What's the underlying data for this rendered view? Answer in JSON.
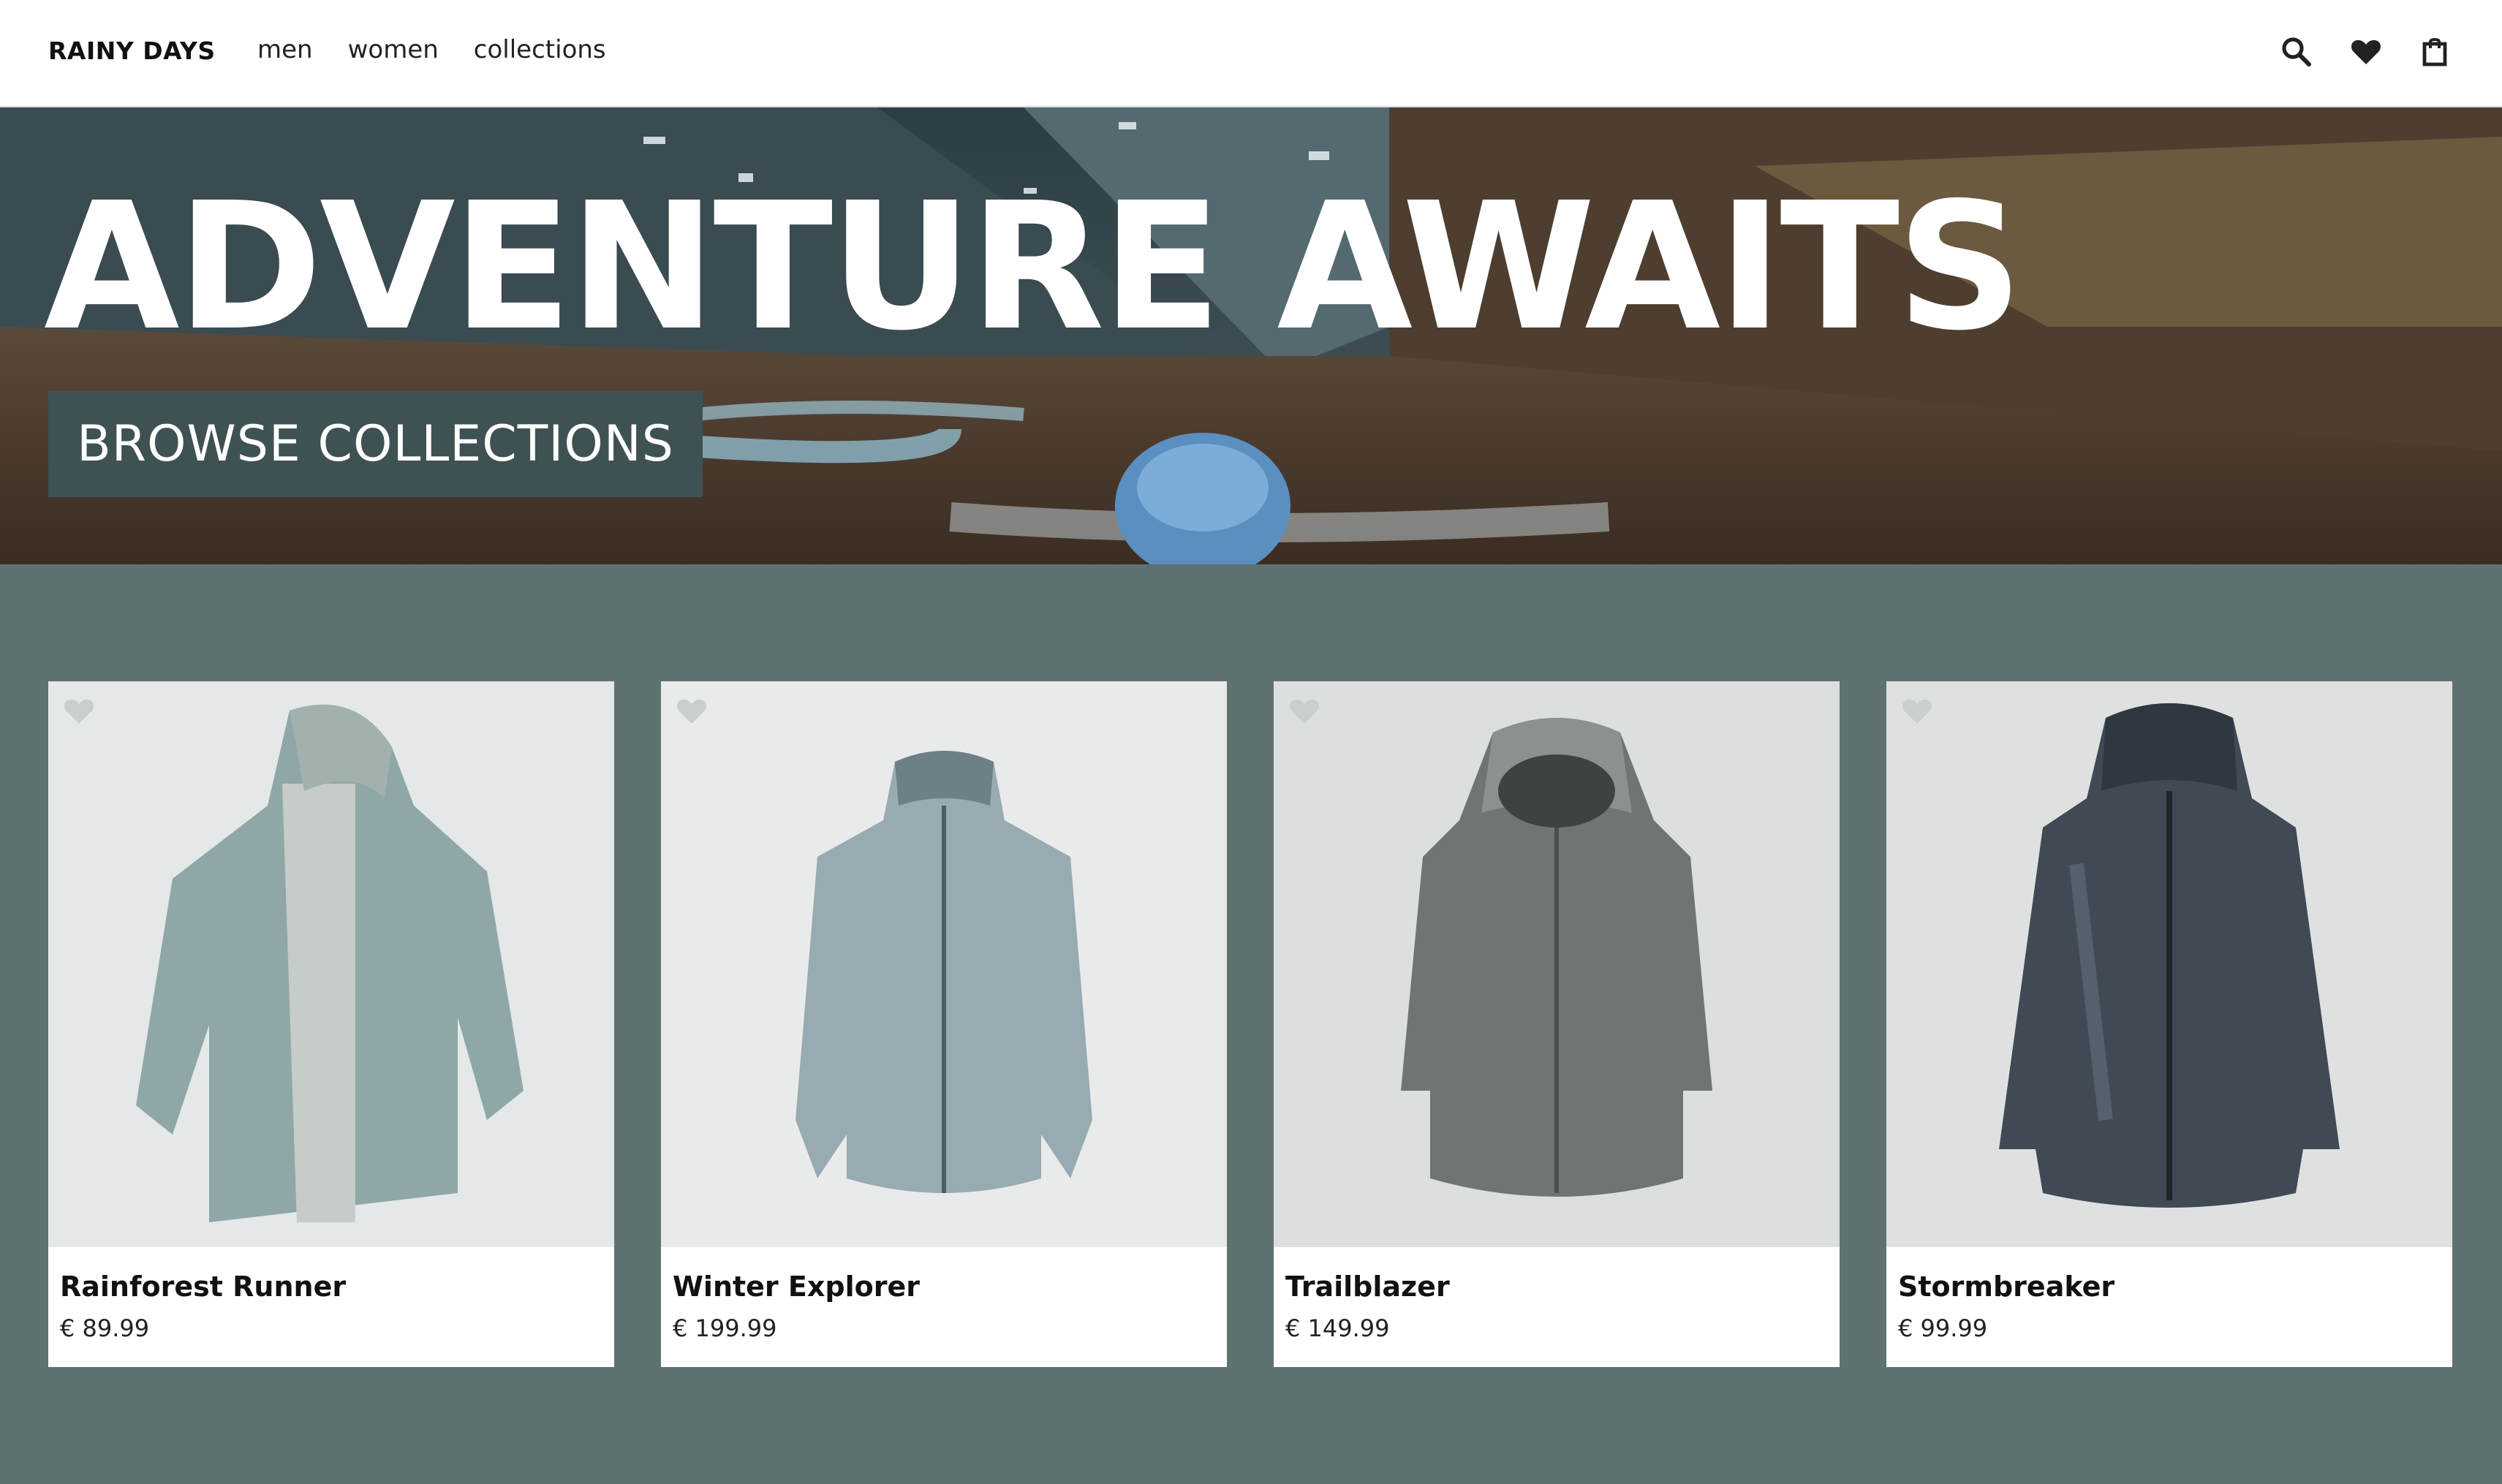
{
  "header": {
    "logo": "RAINY DAYS",
    "nav": [
      "men",
      "women",
      "collections"
    ],
    "icons": [
      "search-icon",
      "heart-icon",
      "shopping-bag-icon"
    ]
  },
  "hero": {
    "title": "ADVENTURE AWAITS",
    "button_label": "BROWSE COLLECTIONS"
  },
  "products": [
    {
      "name": "Rainforest Runner",
      "price": "€ 89.99",
      "color": "#8fa7a6"
    },
    {
      "name": "Winter Explorer",
      "price": "€ 199.99",
      "color": "#98abb2"
    },
    {
      "name": "Trailblazer",
      "price": "€ 149.99",
      "color": "#6f7476"
    },
    {
      "name": "Stormbreaker",
      "price": "€ 99.99",
      "color": "#3f4a55"
    }
  ],
  "colors": {
    "page_background": "#5f7272",
    "button_background": "#3e5153",
    "favorite_icon": "#c9cfcf"
  }
}
